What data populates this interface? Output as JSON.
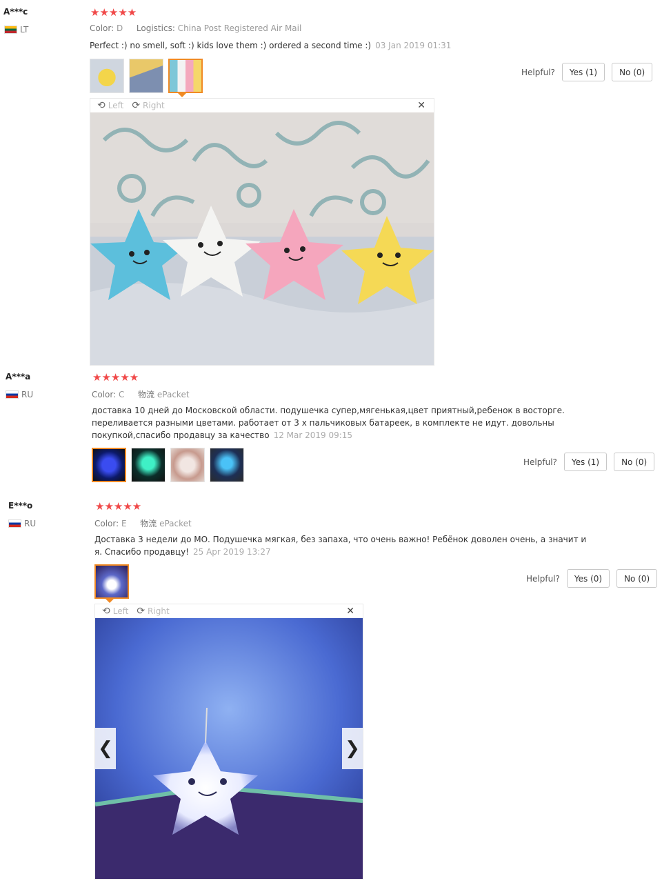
{
  "reviews": [
    {
      "user": "A***c",
      "country": "LT",
      "stars": "★★★★★",
      "color_label": "Color:",
      "color_value": "D",
      "logistics_label": "Logistics:",
      "logistics_value": "China Post Registered Air Mail",
      "text": "Perfect :) no smell, soft :) kids love them :) ordered a second time :)",
      "date": "03 Jan 2019 01:31",
      "helpful_label": "Helpful?",
      "yes_label": "Yes (1)",
      "no_label": "No (0)",
      "viewer_left": "Left",
      "viewer_right": "Right"
    },
    {
      "user": "A***a",
      "country": "RU",
      "stars": "★★★★★",
      "color_label": "Color:",
      "color_value": "C",
      "logistics_label": "物流",
      "logistics_value": "ePacket",
      "text_line1": "доставка 10 дней до Московской области. подушечка супер,мягенькая,цвет приятный,ребенок в восторге.",
      "text_line2": "переливается разными цветами. работает от 3 х пальчиковых батареек, в комплекте не идут. довольны",
      "text_line3": "покупкой,спасибо продавцу за качество",
      "date": "12 Mar 2019 09:15",
      "helpful_label": "Helpful?",
      "yes_label": "Yes (1)",
      "no_label": "No (0)"
    },
    {
      "user": "E***o",
      "country": "RU",
      "stars": "★★★★★",
      "color_label": "Color:",
      "color_value": "E",
      "logistics_label": "物流",
      "logistics_value": "ePacket",
      "text_line1": "Доставка 3 недели до МО. Подушечка мягкая, без запаха, что очень важно! Ребёнок доволен очень, а значит и",
      "text_line2": "я. Спасибо продавцу!",
      "date": "25 Apr 2019 13:27",
      "helpful_label": "Helpful?",
      "yes_label": "Yes (0)",
      "no_label": "No (0)",
      "viewer_left": "Left",
      "viewer_right": "Right"
    }
  ],
  "icons": {
    "rotate_left": "rotate-left-icon",
    "rotate_right": "rotate-right-icon",
    "close": "close-icon",
    "prev": "chevron-left-icon",
    "next": "chevron-right-icon"
  },
  "colors": {
    "star": "#f04848",
    "selected_thumb": "#f08a24"
  }
}
